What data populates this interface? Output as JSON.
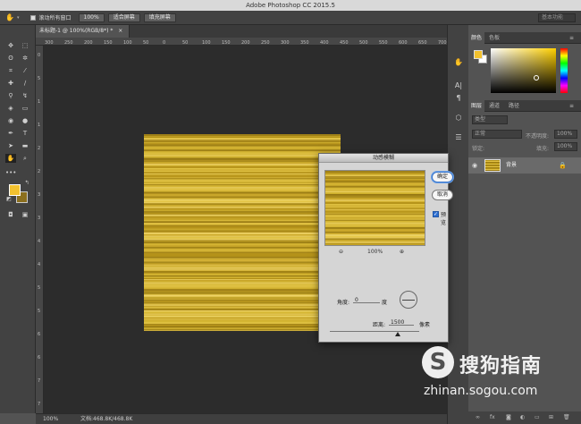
{
  "app": {
    "title": "Adobe Photoshop CC 2015.5"
  },
  "options_bar": {
    "scroll_all_label": "滚动所有窗口",
    "zoom_button": "100%",
    "fit_screen_button": "适合屏幕",
    "fill_screen_button": "填充屏幕",
    "workspace": "基本功能"
  },
  "document": {
    "tab_title": "未标题-1 @ 100%(RGB/8*) *",
    "ruler_top": [
      "300",
      "250",
      "200",
      "150",
      "100",
      "50",
      "0",
      "50",
      "100",
      "150",
      "200",
      "250",
      "300",
      "350",
      "400",
      "450",
      "500",
      "550",
      "600",
      "650",
      "700"
    ],
    "ruler_left": [
      "0",
      "5",
      "1",
      "1",
      "2",
      "2",
      "3",
      "3",
      "4",
      "4",
      "5",
      "5",
      "6",
      "6",
      "7",
      "7"
    ]
  },
  "status": {
    "zoom": "100%",
    "doc_size": "文档:468.8K/468.8K"
  },
  "color_panel": {
    "tabs": [
      "颜色",
      "色板"
    ],
    "foreground": "#f2c12e",
    "background": "#ffffff"
  },
  "layers_panel": {
    "tabs": [
      "图层",
      "通道",
      "路径"
    ],
    "filter_kind": "类型",
    "blend_mode": "正常",
    "opacity_label": "不透明度:",
    "opacity": "100%",
    "lock_label": "锁定:",
    "fill_label": "填充:",
    "fill": "100%",
    "layers": [
      {
        "name": "背景"
      }
    ],
    "footer_icons": [
      "link-icon",
      "fx-icon",
      "mask-icon",
      "adjustment-icon",
      "group-icon",
      "new-layer-icon",
      "trash-icon"
    ]
  },
  "motion_blur_dialog": {
    "title": "动感模糊",
    "ok_button": "确定",
    "cancel_button": "取消",
    "preview_label": "预览",
    "preview_checked": true,
    "zoom_value": "100%",
    "angle_label": "角度:",
    "angle_value": "0",
    "angle_unit": "度",
    "distance_label": "距离:",
    "distance_value": "1500",
    "distance_unit": "像素",
    "distance_fraction": 0.76
  },
  "watermark": {
    "text": "搜狗指南",
    "url": "zhinan.sogou.com"
  },
  "colors": {
    "ui_dark": "#535353",
    "canvas": "#2c2c2c",
    "gold_light": "#e1c043",
    "gold_dark": "#9c7c14"
  }
}
